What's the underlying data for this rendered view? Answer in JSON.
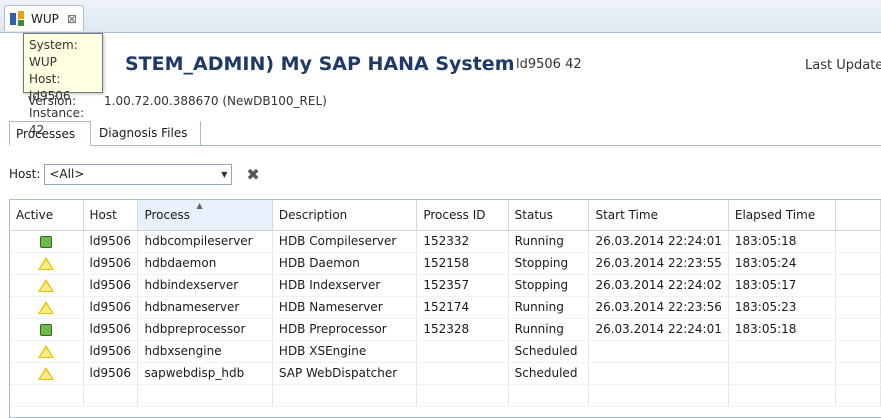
{
  "editor_tab": {
    "title": "WUP",
    "close": "⊠"
  },
  "tooltip": {
    "system": "System: WUP",
    "host": "Host: ld9506",
    "instance": "Instance: 42"
  },
  "header": {
    "system_title": "STEM_ADMIN) My SAP HANA System",
    "system_id": "ld9506 42",
    "last_update": "Last Update",
    "version_label": "Version:",
    "version_value": "1.00.72.00.388670 (NewDB100_REL)"
  },
  "subtabs": [
    {
      "label": "Processes"
    },
    {
      "label": "Diagnosis Files"
    }
  ],
  "filter": {
    "host_label": "Host:",
    "host_value": "<All>"
  },
  "table": {
    "columns": [
      "Active",
      "Host",
      "Process",
      "Description",
      "Process ID",
      "Status",
      "Start Time",
      "Elapsed Time"
    ],
    "rows": [
      {
        "active": "green",
        "host": "ld9506",
        "process": "hdbcompileserver",
        "description": "HDB Compileserver",
        "pid": "152332",
        "status": "Running",
        "start": "26.03.2014 22:24:01",
        "elapsed": "183:05:18"
      },
      {
        "active": "warning",
        "host": "ld9506",
        "process": "hdbdaemon",
        "description": "HDB Daemon",
        "pid": "152158",
        "status": "Stopping",
        "start": "26.03.2014 22:23:55",
        "elapsed": "183:05:24"
      },
      {
        "active": "warning",
        "host": "ld9506",
        "process": "hdbindexserver",
        "description": "HDB Indexserver",
        "pid": "152357",
        "status": "Stopping",
        "start": "26.03.2014 22:24:02",
        "elapsed": "183:05:17"
      },
      {
        "active": "warning",
        "host": "ld9506",
        "process": "hdbnameserver",
        "description": "HDB Nameserver",
        "pid": "152174",
        "status": "Running",
        "start": "26.03.2014 22:23:56",
        "elapsed": "183:05:23"
      },
      {
        "active": "green",
        "host": "ld9506",
        "process": "hdbpreprocessor",
        "description": "HDB Preprocessor",
        "pid": "152328",
        "status": "Running",
        "start": "26.03.2014 22:24:01",
        "elapsed": "183:05:18"
      },
      {
        "active": "warning",
        "host": "ld9506",
        "process": "hdbxsengine",
        "description": "HDB XSEngine",
        "pid": "",
        "status": "Scheduled",
        "start": "",
        "elapsed": ""
      },
      {
        "active": "warning",
        "host": "ld9506",
        "process": "sapwebdisp_hdb",
        "description": "SAP WebDispatcher",
        "pid": "",
        "status": "Scheduled",
        "start": "",
        "elapsed": ""
      }
    ]
  }
}
